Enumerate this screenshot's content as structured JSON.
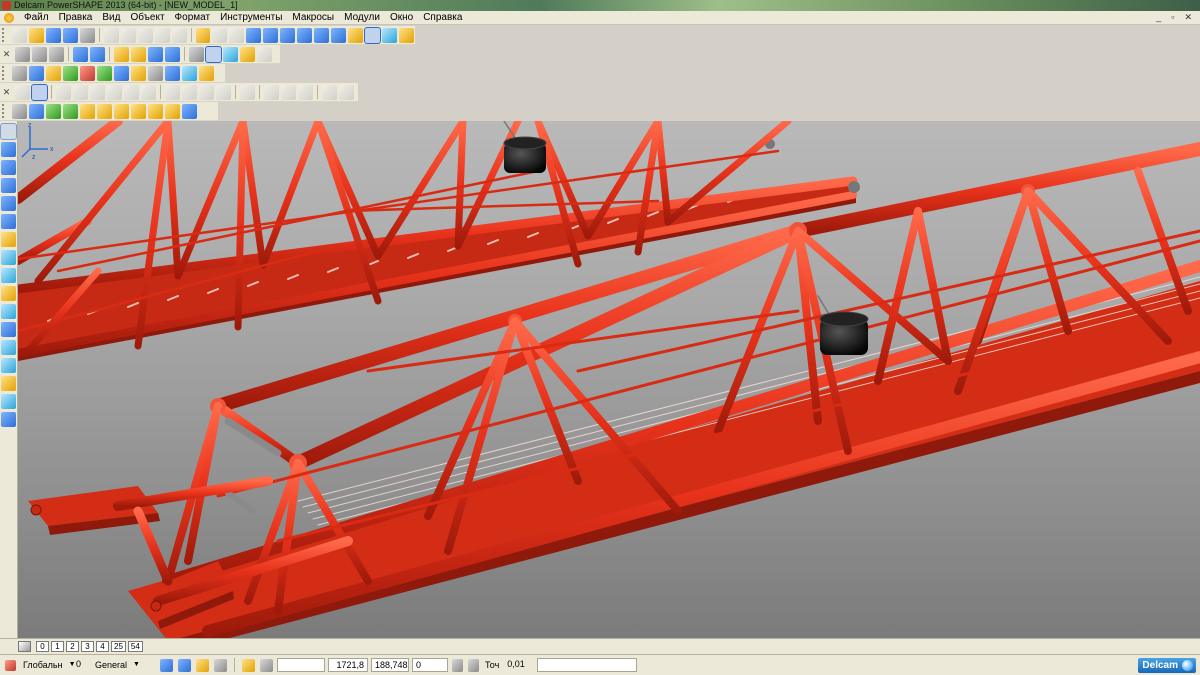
{
  "window": {
    "title": "Delcam PowerSHAPE 2013 (64-bit) - [NEW_MODEL_1]",
    "controls": [
      "_",
      "▫",
      "✕"
    ]
  },
  "menu": {
    "items": [
      "Файл",
      "Правка",
      "Вид",
      "Объект",
      "Формат",
      "Инструменты",
      "Макросы",
      "Модули",
      "Окно",
      "Справка"
    ]
  },
  "viewport": {
    "triad_axes": {
      "z": "z",
      "x": "x",
      "y": "z"
    },
    "background_top": "#b9b9b9",
    "background_bottom": "#7b7b7b",
    "model_color": "#e8321b"
  },
  "layers": {
    "tabs": [
      "0",
      "1",
      "2",
      "3",
      "4",
      "25",
      "54"
    ]
  },
  "status": {
    "workplane": "Глобальн",
    "level_number": "0",
    "level_name": "General",
    "coord_x": "1721,8",
    "coord_y": "188,748",
    "coord_z": "0",
    "snap_label": "Точ",
    "snap_value": "0,01",
    "brand": "Delcam"
  }
}
